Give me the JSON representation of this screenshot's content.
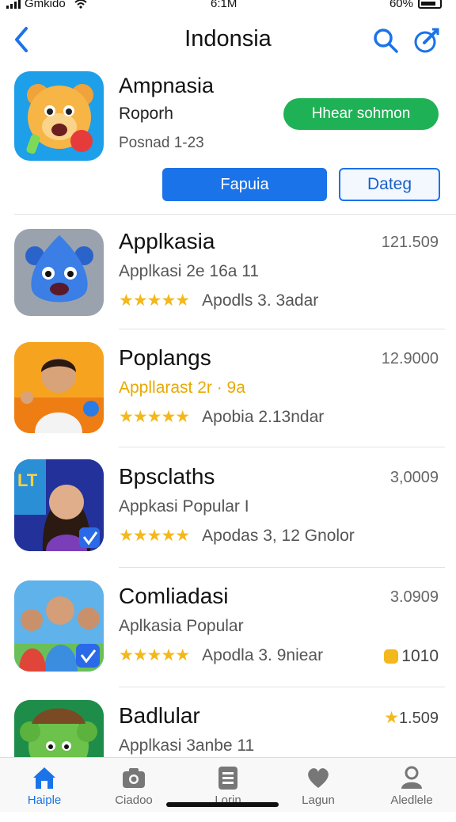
{
  "status_bar": {
    "carrier": "Gmkido",
    "time": "6:1M",
    "battery": "60%"
  },
  "header": {
    "title": "Indonsia"
  },
  "featured": {
    "title": "Ampnasia",
    "subtitle": "Roporh",
    "meta": "Posnad 1-23",
    "get_label": "Hhear sohmon",
    "primary_label": "Fapuia",
    "secondary_label": "Dateg"
  },
  "apps": [
    {
      "title": "Applkasia",
      "subtitle": "Applkasi 2e 16a 11",
      "stars": "★★★★★",
      "rating_text": "Apodls 3. 3adar",
      "count": "121.509",
      "extra": ""
    },
    {
      "title": "Poplangs",
      "subtitle": "Appllarast 2r · 9a",
      "stars": "★★★★★",
      "rating_text": "Apobia 2.13ndar",
      "count": "12.9000",
      "extra": ""
    },
    {
      "title": "Bpsclaths",
      "subtitle": "Appkasi Popular I",
      "stars": "★★★★★",
      "rating_text": "Apodas 3, 12 Gnolor",
      "count": "3,0009",
      "extra": ""
    },
    {
      "title": "Comliadasi",
      "subtitle": "Aplkasia Popular",
      "stars": "★★★★★",
      "rating_text": "Apodla 3. 9niear",
      "count": "3.0909",
      "extra": "1010"
    },
    {
      "title": "Badlular",
      "subtitle": "Applkasi 3anbe 11",
      "stars": "",
      "rating_text": "",
      "count": "1.509",
      "extra": ""
    }
  ],
  "tabs": [
    {
      "label": "Haiple",
      "icon": "home-icon"
    },
    {
      "label": "Ciadoo",
      "icon": "camera-icon"
    },
    {
      "label": "Lorin",
      "icon": "list-icon"
    },
    {
      "label": "Lagun",
      "icon": "heart-icon"
    },
    {
      "label": "Aledlele",
      "icon": "profile-icon"
    }
  ],
  "colors": {
    "accent": "#1a73e8",
    "get_button": "#1fb155",
    "stars": "#f3b81b"
  }
}
